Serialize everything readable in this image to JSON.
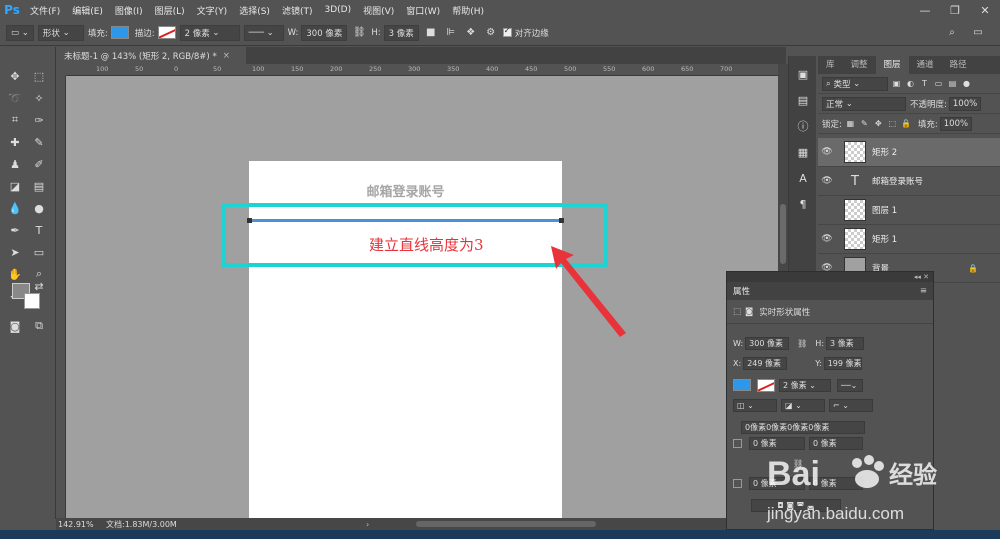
{
  "app": {
    "logo": "Ps"
  },
  "menu": [
    "文件(F)",
    "编辑(E)",
    "图像(I)",
    "图层(L)",
    "文字(Y)",
    "选择(S)",
    "滤镜(T)",
    "3D(D)",
    "视图(V)",
    "窗口(W)",
    "帮助(H)"
  ],
  "options": {
    "mode": "形状",
    "fill_label": "填充:",
    "stroke_label": "描边:",
    "stroke_width": "2 像素",
    "w_label": "W:",
    "w_value": "300 像素",
    "h_label": "H:",
    "h_value": "3 像素",
    "align_edges": "对齐边缘",
    "fill_color": "#2d97e9"
  },
  "doc_tab": {
    "title": "未标题-1 @ 143% (矩形 2, RGB/8#) *",
    "close": "×"
  },
  "ruler_top": [
    "100",
    "50",
    "0",
    "50",
    "100",
    "150",
    "200",
    "250",
    "300",
    "350",
    "400",
    "450",
    "500",
    "550",
    "600",
    "650",
    "700"
  ],
  "canvas": {
    "heading": "邮箱登录账号",
    "annotation": "建立直线高度为3",
    "line_color": "#4d90d8",
    "highlight_color": "#1dd3d3",
    "annotation_color": "#e8333a"
  },
  "status": {
    "zoom": "142.91%",
    "doc": "文档:1.83M/3.00M"
  },
  "layers_panel": {
    "tabs": [
      "库",
      "调整",
      "图层",
      "通道",
      "路径"
    ],
    "filter": "类型",
    "blend": "正常",
    "opacity_label": "不透明度:",
    "opacity": "100%",
    "lock_label": "锁定:",
    "fill_label": "填充:",
    "fill": "100%",
    "layers": [
      {
        "name": "矩形 2",
        "kind": "shape",
        "visible": true,
        "selected": true
      },
      {
        "name": "邮箱登录账号",
        "kind": "text",
        "visible": true,
        "selected": false
      },
      {
        "name": "图层 1",
        "kind": "pixel",
        "visible": false,
        "selected": false
      },
      {
        "name": "矩形 1",
        "kind": "shape",
        "visible": true,
        "selected": false
      },
      {
        "name": "背景",
        "kind": "background",
        "visible": true,
        "selected": false
      }
    ]
  },
  "properties": {
    "title": "属性",
    "subtitle": "实时形状属性",
    "w_label": "W:",
    "w": "300 像素",
    "h_label": "H:",
    "h": "3 像素",
    "x_label": "X:",
    "x": "249 像素",
    "y_label": "Y:",
    "y": "199 像素",
    "stroke_width": "2 像素",
    "corners": "0像素0像素0像素0像素",
    "corner_a": "0 像素",
    "corner_b": "0 像素",
    "corner_c": "0 像素",
    "corner_d": "0 像素"
  },
  "watermark": {
    "brand": "Bai",
    "brand2": "经验",
    "url": "jingyan.baidu.com"
  }
}
